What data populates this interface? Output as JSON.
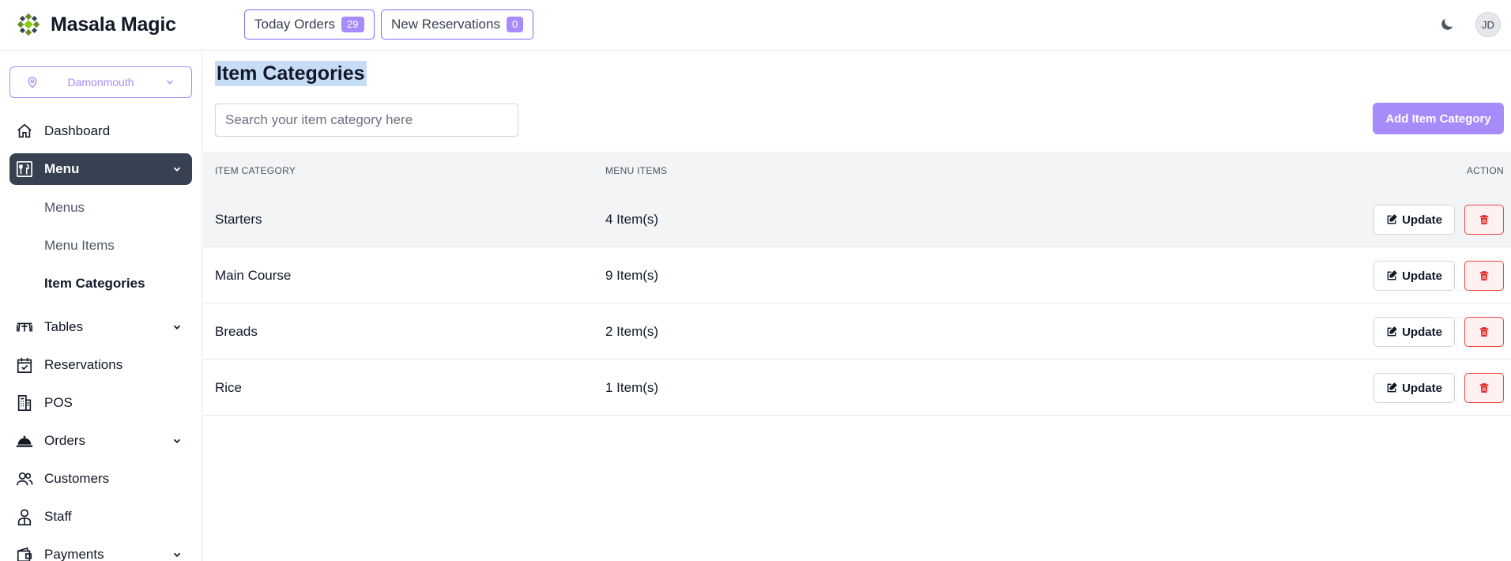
{
  "app": {
    "name": "Masala Magic"
  },
  "header": {
    "today_orders": {
      "label": "Today Orders",
      "count": "29"
    },
    "new_reservations": {
      "label": "New Reservations",
      "count": "0"
    },
    "avatar_initials": "JD",
    "theme_icon": "moon-icon"
  },
  "sidebar": {
    "branch": "Damonmouth",
    "items": [
      {
        "label": "Dashboard",
        "icon": "home-icon"
      },
      {
        "label": "Menu",
        "icon": "menu-card-icon",
        "active": true
      },
      {
        "label": "Tables",
        "icon": "table-icon"
      },
      {
        "label": "Reservations",
        "icon": "calendar-check-icon"
      },
      {
        "label": "POS",
        "icon": "pos-icon"
      },
      {
        "label": "Orders",
        "icon": "cloche-icon"
      },
      {
        "label": "Customers",
        "icon": "users-icon"
      },
      {
        "label": "Staff",
        "icon": "staff-icon"
      },
      {
        "label": "Payments",
        "icon": "wallet-icon"
      }
    ],
    "menu_sub": [
      "Menus",
      "Menu Items",
      "Item Categories"
    ]
  },
  "main": {
    "title": "Item Categories",
    "search_placeholder": "Search your item category here",
    "add_button": "Add Item Category",
    "table": {
      "headers": [
        "ITEM CATEGORY",
        "MENU ITEMS",
        "ACTION"
      ],
      "rows": [
        {
          "category": "Starters",
          "items": "4 Item(s)"
        },
        {
          "category": "Main Course",
          "items": "9 Item(s)"
        },
        {
          "category": "Breads",
          "items": "2 Item(s)"
        },
        {
          "category": "Rice",
          "items": "1 Item(s)"
        }
      ],
      "update_label": "Update"
    }
  },
  "colors": {
    "accent": "#a78bfa",
    "active_nav": "#374151",
    "danger": "#ef4444"
  }
}
